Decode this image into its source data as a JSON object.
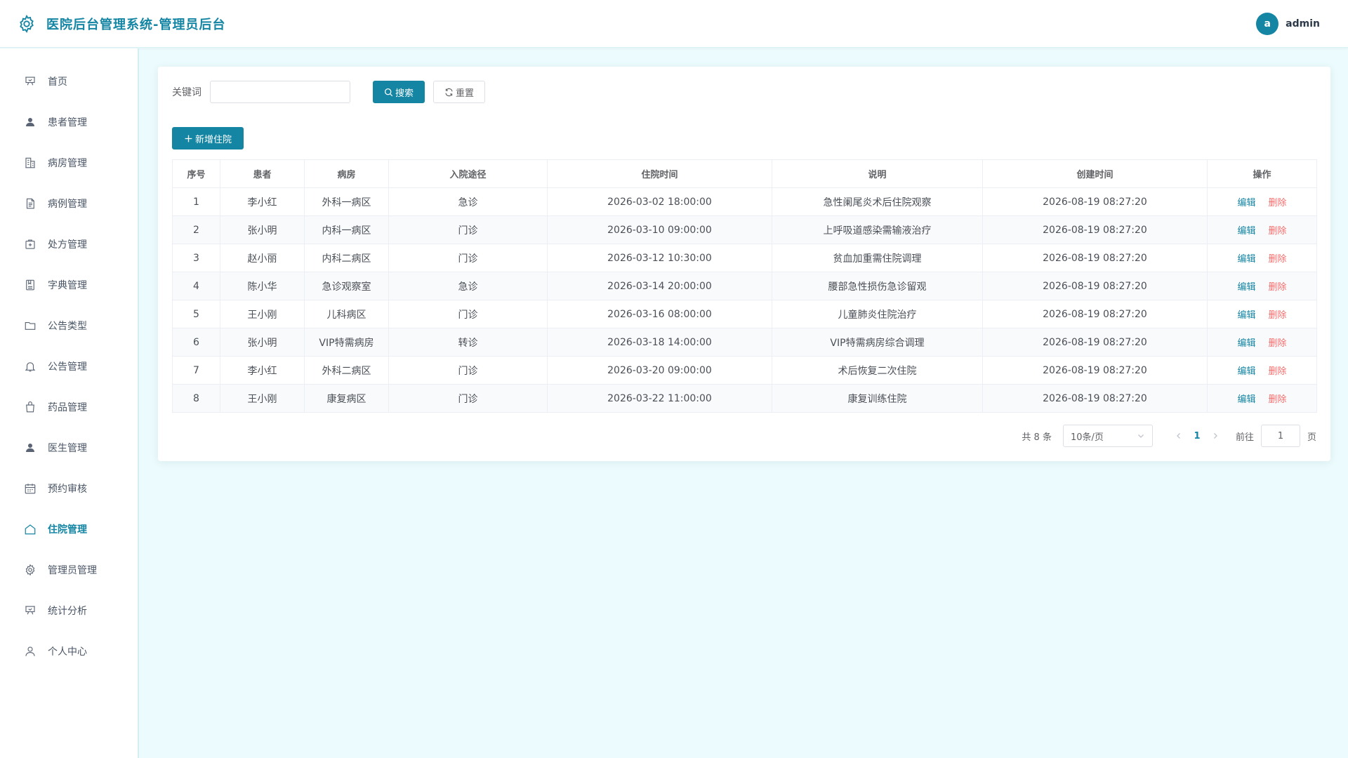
{
  "header": {
    "title": "医院后台管理系统-管理员后台",
    "avatar_letter": "a",
    "username": "admin"
  },
  "sidebar": {
    "items": [
      {
        "label": "首页",
        "icon": "presentation-icon"
      },
      {
        "label": "患者管理",
        "icon": "user-filled-icon"
      },
      {
        "label": "病房管理",
        "icon": "building-icon"
      },
      {
        "label": "病例管理",
        "icon": "document-icon"
      },
      {
        "label": "处方管理",
        "icon": "first-aid-icon"
      },
      {
        "label": "字典管理",
        "icon": "notebook-icon"
      },
      {
        "label": "公告类型",
        "icon": "folder-icon"
      },
      {
        "label": "公告管理",
        "icon": "bell-icon"
      },
      {
        "label": "药品管理",
        "icon": "bag-icon"
      },
      {
        "label": "医生管理",
        "icon": "user-filled-icon"
      },
      {
        "label": "预约审核",
        "icon": "calendar-icon"
      },
      {
        "label": "住院管理",
        "icon": "house-icon",
        "active": true
      },
      {
        "label": "管理员管理",
        "icon": "gear-icon"
      },
      {
        "label": "统计分析",
        "icon": "presentation-icon"
      },
      {
        "label": "个人中心",
        "icon": "user-outline-icon"
      }
    ]
  },
  "search": {
    "label": "关键词",
    "value": "",
    "placeholder": "",
    "search_label": "搜索",
    "reset_label": "重置"
  },
  "toolbar": {
    "add_label": "新增住院"
  },
  "table": {
    "columns": [
      "序号",
      "患者",
      "病房",
      "入院途径",
      "住院时间",
      "说明",
      "创建时间",
      "操作"
    ],
    "edit_label": "编辑",
    "delete_label": "删除",
    "rows": [
      [
        "1",
        "李小红",
        "外科一病区",
        "急诊",
        "2026-03-02 18:00:00",
        "急性阑尾炎术后住院观察",
        "2026-08-19 08:27:20"
      ],
      [
        "2",
        "张小明",
        "内科一病区",
        "门诊",
        "2026-03-10 09:00:00",
        "上呼吸道感染需输液治疗",
        "2026-08-19 08:27:20"
      ],
      [
        "3",
        "赵小丽",
        "内科二病区",
        "门诊",
        "2026-03-12 10:30:00",
        "贫血加重需住院调理",
        "2026-08-19 08:27:20"
      ],
      [
        "4",
        "陈小华",
        "急诊观察室",
        "急诊",
        "2026-03-14 20:00:00",
        "腰部急性损伤急诊留观",
        "2026-08-19 08:27:20"
      ],
      [
        "5",
        "王小刚",
        "儿科病区",
        "门诊",
        "2026-03-16 08:00:00",
        "儿童肺炎住院治疗",
        "2026-08-19 08:27:20"
      ],
      [
        "6",
        "张小明",
        "VIP特需病房",
        "转诊",
        "2026-03-18 14:00:00",
        "VIP特需病房综合调理",
        "2026-08-19 08:27:20"
      ],
      [
        "7",
        "李小红",
        "外科二病区",
        "门诊",
        "2026-03-20 09:00:00",
        "术后恢复二次住院",
        "2026-08-19 08:27:20"
      ],
      [
        "8",
        "王小刚",
        "康复病区",
        "门诊",
        "2026-03-22 11:00:00",
        "康复训练住院",
        "2026-08-19 08:27:20"
      ]
    ]
  },
  "pagination": {
    "total_text": "共 8 条",
    "page_size": "10条/页",
    "current_page": "1",
    "goto_label": "前往",
    "goto_value": "1",
    "goto_suffix": "页"
  },
  "colors": {
    "accent": "#1485a3",
    "danger": "#f56c6c",
    "background": "#ecfbfd"
  }
}
